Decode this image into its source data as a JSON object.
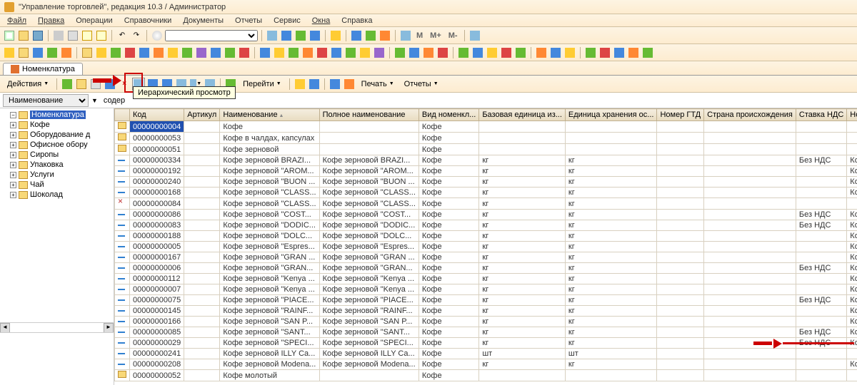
{
  "window": {
    "title": "\"Управление торговлей\", редакция 10.3 / Администратор"
  },
  "menu": [
    "Файл",
    "Правка",
    "Операции",
    "Справочники",
    "Документы",
    "Отчеты",
    "Сервис",
    "Окна",
    "Справка"
  ],
  "toolbar2_text": {
    "m": "M",
    "mplus": "M+",
    "mminus": "M-"
  },
  "tab": {
    "label": "Номенклатура"
  },
  "local_toolbar": {
    "actions": "Действия",
    "goto": "Перейти",
    "print": "Печать",
    "reports": "Отчеты"
  },
  "tooltip": "Иерархический просмотр",
  "filter": {
    "field": "Наименование",
    "mid": "содер"
  },
  "tree": {
    "root": "Номенклатура",
    "items": [
      "Кофе",
      "Оборудование д",
      "Офисное обору",
      "Сиропы",
      "Упаковка",
      "Услуги",
      "Чай",
      "Шоколад"
    ]
  },
  "grid": {
    "columns": [
      "",
      "Код",
      "Артикул",
      "Наименование",
      "Полное наименование",
      "Вид номенкл...",
      "Базовая единица из...",
      "Единица хранения ос...",
      "Номер ГТД",
      "Страна происхождения",
      "Ставка НДС",
      "Номенклатурная группа"
    ],
    "sorted_col": 3,
    "rows": [
      {
        "t": "folder",
        "code": "00000000004",
        "name": "Кофе",
        "vid": "Кофе"
      },
      {
        "t": "folder",
        "code": "00000000053",
        "name": "Кофе в чалдах, капсулах",
        "vid": "Кофе"
      },
      {
        "t": "folder",
        "code": "00000000051",
        "name": "Кофе зерновой",
        "vid": "Кофе"
      },
      {
        "t": "item",
        "code": "00000000334",
        "name": "Кофе зерновой  BRAZI...",
        "full": "Кофе зерновой  BRAZI...",
        "vid": "Кофе",
        "bu": "кг",
        "hu": "кг",
        "nds": "Без НДС",
        "grp": "Кофе в зернах"
      },
      {
        "t": "item",
        "code": "00000000192",
        "name": "Кофе зерновой \"AROM...",
        "full": "Кофе зерновой \"AROM...",
        "vid": "Кофе",
        "bu": "кг",
        "hu": "кг",
        "grp": "Кофе в зернах"
      },
      {
        "t": "item",
        "code": "00000000240",
        "name": "Кофе зерновой \"BUON ...",
        "full": "Кофе зерновой \"BUON ...",
        "vid": "Кофе",
        "bu": "кг",
        "hu": "кг",
        "grp": "Кофе в зернах"
      },
      {
        "t": "item",
        "code": "00000000168",
        "name": "Кофе зерновой \"CLASS...",
        "full": "Кофе зерновой \"CLASS...",
        "vid": "Кофе",
        "bu": "кг",
        "hu": "кг",
        "grp": "Кофе в зернах"
      },
      {
        "t": "item-del",
        "code": "00000000084",
        "name": "Кофе зерновой \"CLASS...",
        "full": "Кофе зерновой \"CLASS...",
        "vid": "Кофе",
        "bu": "кг",
        "hu": "кг"
      },
      {
        "t": "item",
        "code": "00000000086",
        "name": "Кофе зерновой \"COST...",
        "full": "Кофе зерновой \"COST...",
        "vid": "Кофе",
        "bu": "кг",
        "hu": "кг",
        "nds": "Без НДС",
        "grp": "Кофе в зернах"
      },
      {
        "t": "item",
        "code": "00000000083",
        "name": "Кофе зерновой \"DODIC...",
        "full": "Кофе зерновой \"DODIC...",
        "vid": "Кофе",
        "bu": "кг",
        "hu": "кг",
        "nds": "Без НДС",
        "grp": "Кофе в зернах"
      },
      {
        "t": "item",
        "code": "00000000188",
        "name": "Кофе зерновой \"DOLC...",
        "full": "Кофе зерновой \"DOLC...",
        "vid": "Кофе",
        "bu": "кг",
        "hu": "кг",
        "grp": "Кофе в зернах"
      },
      {
        "t": "item",
        "code": "00000000005",
        "name": "Кофе зерновой \"Espres...",
        "full": "Кофе зерновой \"Espres...",
        "vid": "Кофе",
        "bu": "кг",
        "hu": "кг",
        "grp": "Кофе в зернах"
      },
      {
        "t": "item",
        "code": "00000000167",
        "name": "Кофе зерновой \"GRAN ...",
        "full": "Кофе зерновой \"GRAN ...",
        "vid": "Кофе",
        "bu": "кг",
        "hu": "кг",
        "grp": "Кофе в зернах"
      },
      {
        "t": "item",
        "code": "00000000006",
        "name": "Кофе зерновой \"GRAN...",
        "full": "Кофе зерновой \"GRAN...",
        "vid": "Кофе",
        "bu": "кг",
        "hu": "кг",
        "nds": "Без НДС",
        "grp": "Кофе в зернах"
      },
      {
        "t": "item",
        "code": "00000000112",
        "name": "Кофе зерновой \"Kenya ...",
        "full": "Кофе зерновой \"Kenya ...",
        "vid": "Кофе",
        "bu": "кг",
        "hu": "кг",
        "grp": "Кофе в зернах"
      },
      {
        "t": "item",
        "code": "00000000007",
        "name": "Кофе зерновой \"Kenya ...",
        "full": "Кофе зерновой \"Kenya ...",
        "vid": "Кофе",
        "bu": "кг",
        "hu": "кг",
        "grp": "Кофе в зернах"
      },
      {
        "t": "item",
        "code": "00000000075",
        "name": "Кофе зерновой \"PIACE...",
        "full": "Кофе зерновой \"PIACE...",
        "vid": "Кофе",
        "bu": "кг",
        "hu": "кг",
        "nds": "Без НДС",
        "grp": "Кофе в зернах"
      },
      {
        "t": "item",
        "code": "00000000145",
        "name": "Кофе зерновой \"RAINF...",
        "full": "Кофе зерновой \"RAINF...",
        "vid": "Кофе",
        "bu": "кг",
        "hu": "кг",
        "grp": "Кофе в зернах"
      },
      {
        "t": "item",
        "code": "00000000166",
        "name": "Кофе зерновой \"SAN P...",
        "full": "Кофе зерновой \"SAN P...",
        "vid": "Кофе",
        "bu": "кг",
        "hu": "кг",
        "grp": "Кофе в зернах"
      },
      {
        "t": "item",
        "code": "00000000085",
        "name": "Кофе зерновой \"SANT...",
        "full": "Кофе зерновой \"SANT...",
        "vid": "Кофе",
        "bu": "кг",
        "hu": "кг",
        "nds": "Без НДС",
        "grp": "Кофе в зернах"
      },
      {
        "t": "item",
        "code": "00000000029",
        "name": "Кофе зерновой \"SPECI...",
        "full": "Кофе зерновой \"SPECI...",
        "vid": "Кофе",
        "bu": "кг",
        "hu": "кг",
        "nds": "Без НДС",
        "grp": "Кофе в зернах"
      },
      {
        "t": "item",
        "code": "00000000241",
        "name": "Кофе зерновой ILLY Ca...",
        "full": "Кофе зерновой ILLY Ca...",
        "vid": "Кофе",
        "bu": "шт",
        "hu": "шт"
      },
      {
        "t": "item",
        "code": "00000000208",
        "name": "Кофе зерновой Modena...",
        "full": "Кофе зерновой Modena...",
        "vid": "Кофе",
        "bu": "кг",
        "hu": "кг",
        "grp": "Кофе в зернах"
      },
      {
        "t": "folder",
        "code": "00000000052",
        "name": "Кофе молотый",
        "vid": "Кофе"
      }
    ]
  }
}
